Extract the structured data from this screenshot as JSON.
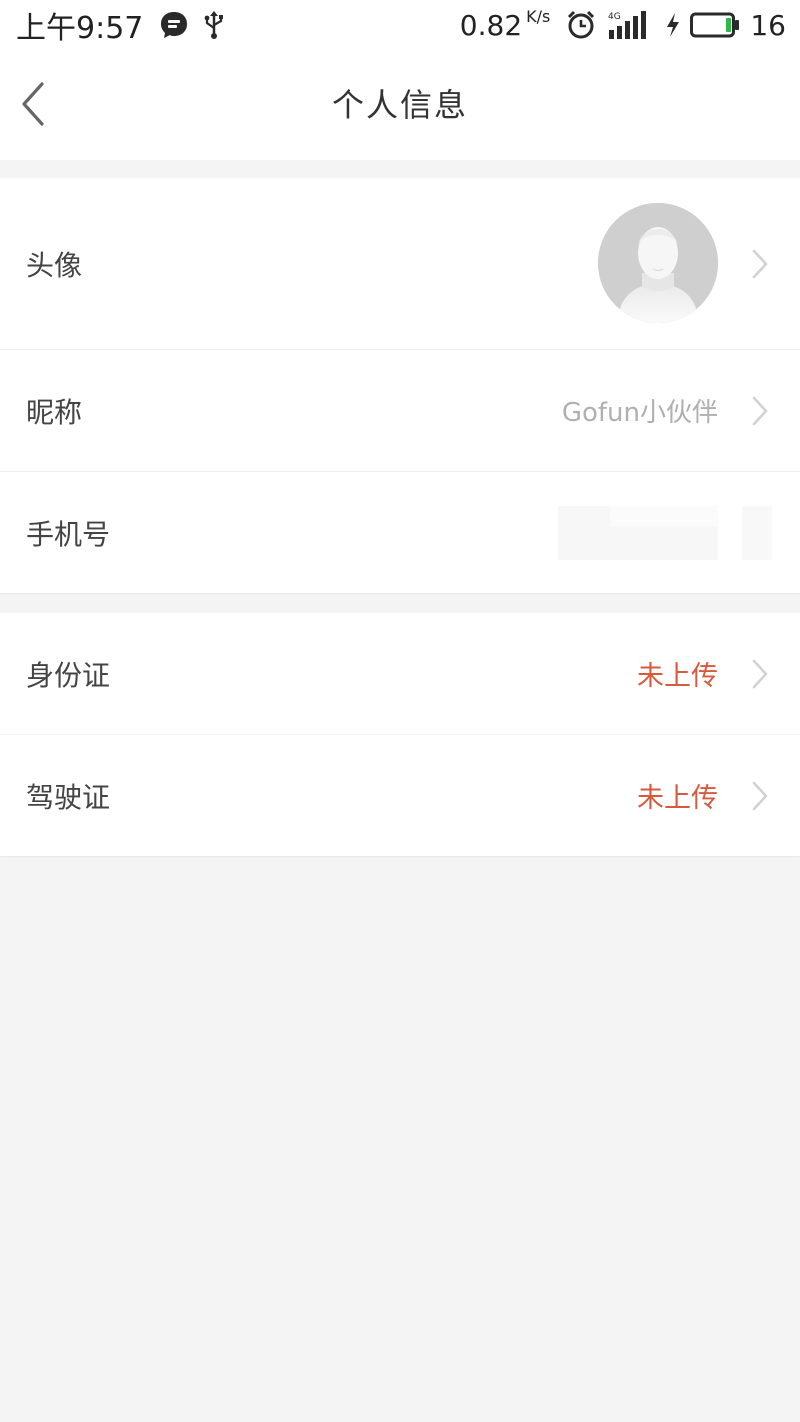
{
  "status_bar": {
    "time": "上午9:57",
    "net_speed": "0.82",
    "net_speed_unit": "K/s",
    "network_type": "4G",
    "battery_level": "16",
    "icons": [
      "message-icon",
      "usb-icon",
      "alarm-icon",
      "signal-icon",
      "charging-icon",
      "battery-icon"
    ],
    "battery_color": "#2db84a"
  },
  "header": {
    "title": "个人信息",
    "back_icon": "chevron-left-icon"
  },
  "profile": {
    "avatar_label": "头像",
    "nickname_label": "昵称",
    "nickname_value": "Gofun小伙伴",
    "phone_label": "手机号",
    "phone_value": ""
  },
  "documents": {
    "id_card_label": "身份证",
    "id_card_status": "未上传",
    "license_label": "驾驶证",
    "license_status": "未上传"
  },
  "colors": {
    "warning": "#d85a3e",
    "background": "#f4f4f4",
    "muted_text": "#b0b0b0"
  }
}
